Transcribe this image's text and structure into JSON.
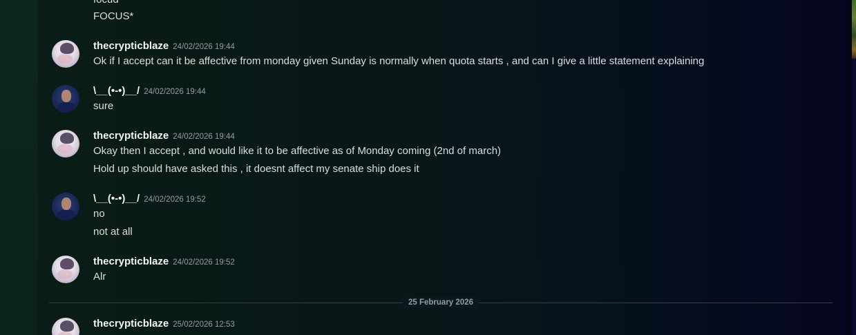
{
  "messages": {
    "m0": {
      "lines": [
        "focud*",
        "FOCUS*"
      ]
    },
    "m1": {
      "username": "thecrypticblaze",
      "timestamp": "24/02/2026 19:44",
      "lines": [
        "Ok if I accept can it be affective from monday given Sunday is normally when quota starts , and can I give a little statement explaining"
      ]
    },
    "m2": {
      "username": "\\__(•-•)__/",
      "timestamp": "24/02/2026 19:44",
      "lines": [
        "sure"
      ]
    },
    "m3": {
      "username": "thecrypticblaze",
      "timestamp": "24/02/2026 19:44",
      "lines": [
        "Okay then I accept , and would like it to be affective as of Monday coming (2nd of march)",
        "Hold up should have asked this , it doesnt affect my senate ship does it"
      ]
    },
    "m4": {
      "username": "\\__(•-•)__/",
      "timestamp": "24/02/2026 19:52",
      "lines": [
        "no",
        "not at all"
      ]
    },
    "m5": {
      "username": "thecrypticblaze",
      "timestamp": "24/02/2026 19:52",
      "lines": [
        "Alr"
      ]
    },
    "m6": {
      "username": "thecrypticblaze",
      "timestamp": "25/02/2026 12:53"
    }
  },
  "date_divider": "25 February 2026",
  "colors": {
    "username": "#f2f3f5",
    "message_text": "#dbdee1",
    "timestamp": "#949ba4",
    "divider": "#3a3f47"
  }
}
